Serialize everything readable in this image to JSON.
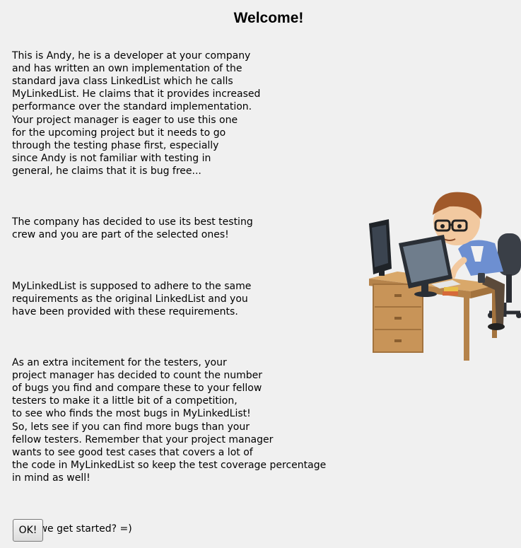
{
  "dialog": {
    "title": "Welcome!",
    "paragraphs": [
      "This is Andy, he is a developer at your company\nand has written an own implementation of the\nstandard java class LinkedList which he calls\nMyLinkedList. He claims that it provides increased\nperformance over the standard implementation.\nYour project manager is eager to use this one\nfor the upcoming project but it needs to go\nthrough the testing phase first, especially\nsince Andy is not familiar with testing in\ngeneral, he claims that it is bug free...",
      "The company has decided to use its best testing\ncrew and you are part of the selected ones!",
      "MyLinkedList is supposed to adhere to the same\nrequirements as the original LinkedList and you\nhave been provided with these requirements.",
      "As an extra incitement for the testers, your\nproject manager has decided to count the number\nof bugs you find and compare these to your fellow\ntesters to make it a little bit of a competition,\nto see who finds the most bugs in MyLinkedList!\nSo, lets see if you can find more bugs than your\nfellow testers. Remember that your project manager\nwants to see good test cases that covers a lot of\nthe code in MyLinkedList so keep the test coverage percentage\nin mind as well!",
      "Shall we get started? =)"
    ],
    "ok_label": "OK!"
  },
  "illustration": {
    "icon": "developer-at-desk-icon"
  }
}
